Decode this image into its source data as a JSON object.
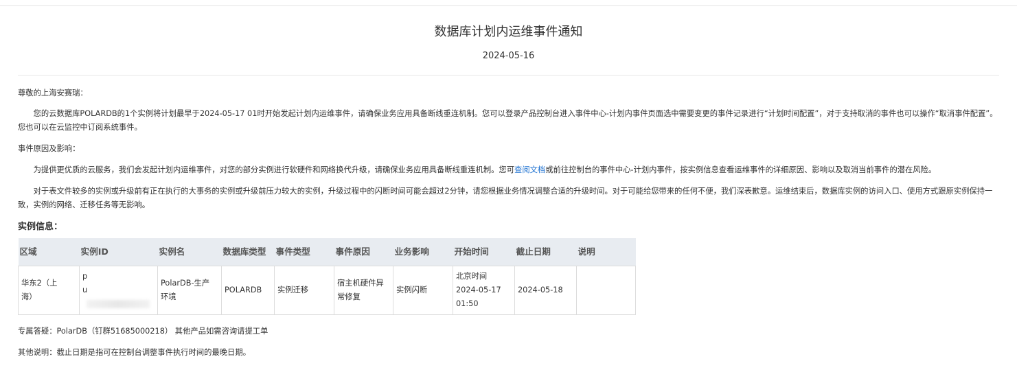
{
  "notice": {
    "title": "数据库计划内运维事件通知",
    "date": "2024-05-16"
  },
  "body": {
    "greeting": "尊敬的上海安赛瑞：",
    "paragraph1": "您的云数据库POLARDB的1个实例将计划最早于2024-05-17 01时开始发起计划内运维事件，请确保业务应用具备断线重连机制。您可以登录产品控制台进入事件中心-计划内事件页面选中需要变更的事件记录进行“计划时间配置”，对于支持取消的事件也可以操作“取消事件配置”。您也可以在云监控中订阅系统事件。",
    "reason_label": "事件原因及影响：",
    "paragraph2_before_link": "为提供更优质的云服务，我们会发起计划内运维事件，对您的部分实例进行软硬件和网络换代升级，请确保业务应用具备断线重连机制。您可",
    "paragraph2_link": "查阅文档",
    "paragraph2_after_link": "或前往控制台的事件中心-计划内事件，按实例信息查看运维事件的详细原因、影响以及取消当前事件的潜在风险。",
    "paragraph3": "对于表文件较多的实例或升级前有正在执行的大事务的实例或升级前压力较大的实例，升级过程中的闪断时间可能会超过2分钟，请您根据业务情况调整合适的升级时间。对于可能给您带来的任何不便，我们深表歉意。运维结束后，数据库实例的访问入口、使用方式跟原实例保持一致，实例的网络、迁移任务等无影响。"
  },
  "instances": {
    "section_title": "实例信息：",
    "columns": [
      "区域",
      "实例ID",
      "实例名",
      "数据库类型",
      "事件类型",
      "事件原因",
      "业务影响",
      "开始时间",
      "截止日期",
      "说明"
    ],
    "rows": [
      {
        "region_line1": "华东2（上",
        "region_line2": "海）",
        "instance_id_line1": "p",
        "instance_id_line2": "u",
        "instance_name_line1": "PolarDB-生产",
        "instance_name_line2": "环境",
        "db_type": "POLARDB",
        "event_type": "实例迁移",
        "event_reason_line1": "宿主机硬件异",
        "event_reason_line2": "常修复",
        "impact": "实例闪断",
        "start_line1": "北京时间",
        "start_line2": "2024-05-17",
        "start_line3": "01:50",
        "deadline": "2024-05-18",
        "note": ""
      }
    ]
  },
  "footer": {
    "support": "专属答疑：PolarDB（钉群51685000218） 其他产品如需咨询请提工单",
    "other_note": "其他说明：截止日期是指可在控制台调整事件执行时间的最晚日期。"
  }
}
